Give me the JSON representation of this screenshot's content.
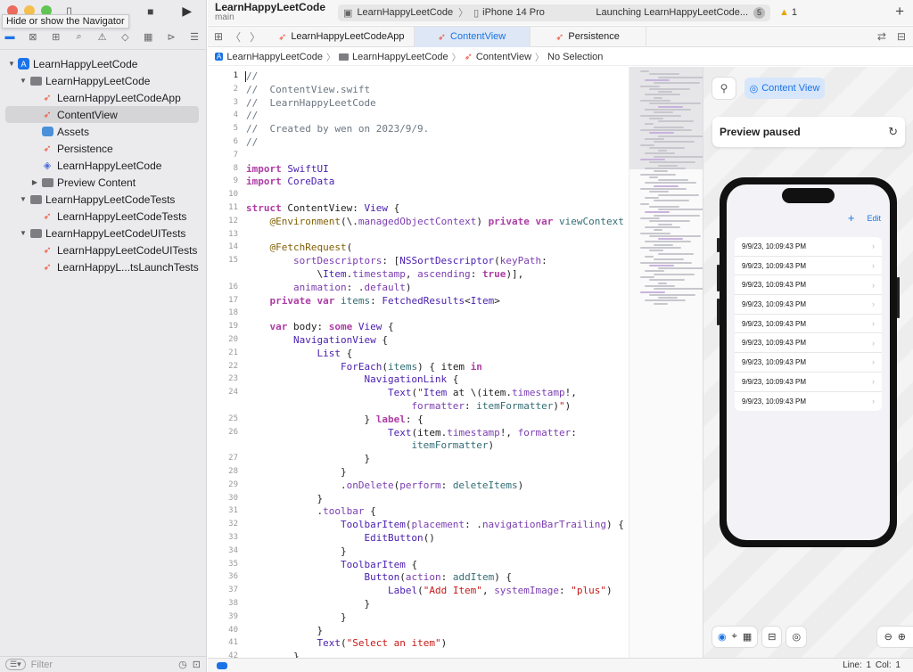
{
  "window": {
    "tooltip": "Hide or show the Navigator",
    "project_title": "LearnHappyLeetCode",
    "branch": "main",
    "scheme": "LearnHappyLeetCode",
    "device": "iPhone 14 Pro",
    "status": "Launching LearnHappyLeetCode...",
    "status_count": "5",
    "warnings": "1"
  },
  "colors": {
    "accent": "#1a73e8",
    "swift": "#f05138",
    "warning": "#e6a400"
  },
  "navigator": {
    "tree": [
      {
        "label": "LearnHappyLeetCode",
        "icon": "project-icon",
        "level": 0,
        "disclosure": "open"
      },
      {
        "label": "LearnHappyLeetCode",
        "icon": "folder-icon",
        "level": 1,
        "disclosure": "open"
      },
      {
        "label": "LearnHappyLeetCodeApp",
        "icon": "swift-file-icon",
        "level": 2
      },
      {
        "label": "ContentView",
        "icon": "swift-file-icon",
        "level": 2,
        "selected": true
      },
      {
        "label": "Assets",
        "icon": "asset-catalog-icon",
        "level": 2
      },
      {
        "label": "Persistence",
        "icon": "swift-file-icon",
        "level": 2
      },
      {
        "label": "LearnHappyLeetCode",
        "icon": "core-data-icon",
        "level": 2
      },
      {
        "label": "Preview Content",
        "icon": "folder-icon",
        "level": 2,
        "disclosure": "closed"
      },
      {
        "label": "LearnHappyLeetCodeTests",
        "icon": "folder-icon",
        "level": 1,
        "disclosure": "open"
      },
      {
        "label": "LearnHappyLeetCodeTests",
        "icon": "swift-file-icon",
        "level": 2
      },
      {
        "label": "LearnHappyLeetCodeUITests",
        "icon": "folder-icon",
        "level": 1,
        "disclosure": "open"
      },
      {
        "label": "LearnHappyLeetCodeUITests",
        "icon": "swift-file-icon",
        "level": 2
      },
      {
        "label": "LearnHappyL...tsLaunchTests",
        "icon": "swift-file-icon",
        "level": 2
      }
    ],
    "filter_placeholder": "Filter"
  },
  "tabs": [
    {
      "label": "LearnHappyLeetCodeApp",
      "active": false
    },
    {
      "label": "ContentView",
      "active": true
    },
    {
      "label": "Persistence",
      "active": false
    }
  ],
  "breadcrumb": [
    "LearnHappyLeetCode",
    "LearnHappyLeetCode",
    "ContentView",
    "No Selection"
  ],
  "editor": {
    "lines": [
      {
        "n": "1",
        "t": "//"
      },
      {
        "n": "2",
        "t": "//  ContentView.swift"
      },
      {
        "n": "3",
        "t": "//  LearnHappyLeetCode"
      },
      {
        "n": "4",
        "t": "//"
      },
      {
        "n": "5",
        "t": "//  Created by wen on 2023/9/9."
      },
      {
        "n": "6",
        "t": "//"
      },
      {
        "n": "7",
        "t": ""
      },
      {
        "n": "8",
        "t": "import SwiftUI"
      },
      {
        "n": "9",
        "t": "import CoreData"
      },
      {
        "n": "10",
        "t": ""
      },
      {
        "n": "11",
        "t": "struct ContentView: View {"
      },
      {
        "n": "12",
        "t": "    @Environment(\\.managedObjectContext) private var viewContext"
      },
      {
        "n": "13",
        "t": ""
      },
      {
        "n": "14",
        "t": "    @FetchRequest("
      },
      {
        "n": "15",
        "t": "        sortDescriptors: [NSSortDescriptor(keyPath:"
      },
      {
        "n": "",
        "t": "            \\Item.timestamp, ascending: true)],"
      },
      {
        "n": "16",
        "t": "        animation: .default)"
      },
      {
        "n": "17",
        "t": "    private var items: FetchedResults<Item>"
      },
      {
        "n": "18",
        "t": ""
      },
      {
        "n": "19",
        "t": "    var body: some View {"
      },
      {
        "n": "20",
        "t": "        NavigationView {"
      },
      {
        "n": "21",
        "t": "            List {"
      },
      {
        "n": "22",
        "t": "                ForEach(items) { item in"
      },
      {
        "n": "23",
        "t": "                    NavigationLink {"
      },
      {
        "n": "24",
        "t": "                        Text(\"Item at \\(item.timestamp!,"
      },
      {
        "n": "",
        "t": "                            formatter: itemFormatter)\")"
      },
      {
        "n": "25",
        "t": "                    } label: {"
      },
      {
        "n": "26",
        "t": "                        Text(item.timestamp!, formatter:"
      },
      {
        "n": "",
        "t": "                            itemFormatter)"
      },
      {
        "n": "27",
        "t": "                    }"
      },
      {
        "n": "28",
        "t": "                }"
      },
      {
        "n": "29",
        "t": "                .onDelete(perform: deleteItems)"
      },
      {
        "n": "30",
        "t": "            }"
      },
      {
        "n": "31",
        "t": "            .toolbar {"
      },
      {
        "n": "32",
        "t": "                ToolbarItem(placement: .navigationBarTrailing) {"
      },
      {
        "n": "33",
        "t": "                    EditButton()"
      },
      {
        "n": "34",
        "t": "                }"
      },
      {
        "n": "35",
        "t": "                ToolbarItem {"
      },
      {
        "n": "36",
        "t": "                    Button(action: addItem) {"
      },
      {
        "n": "37",
        "t": "                        Label(\"Add Item\", systemImage: \"plus\")"
      },
      {
        "n": "38",
        "t": "                    }"
      },
      {
        "n": "39",
        "t": "                }"
      },
      {
        "n": "40",
        "t": "            }"
      },
      {
        "n": "41",
        "t": "            Text(\"Select an item\")"
      },
      {
        "n": "42",
        "t": "        }"
      }
    ]
  },
  "preview": {
    "content_view_label": "Content View",
    "paused_label": "Preview paused",
    "edit_label": "Edit",
    "items": [
      "9/9/23, 10:09:43 PM",
      "9/9/23, 10:09:43 PM",
      "9/9/23, 10:09:43 PM",
      "9/9/23, 10:09:43 PM",
      "9/9/23, 10:09:43 PM",
      "9/9/23, 10:09:43 PM",
      "9/9/23, 10:09:43 PM",
      "9/9/23, 10:09:43 PM",
      "9/9/23, 10:09:43 PM"
    ]
  },
  "statusbar": {
    "line": "Line: 1",
    "col": "Col: 1"
  }
}
